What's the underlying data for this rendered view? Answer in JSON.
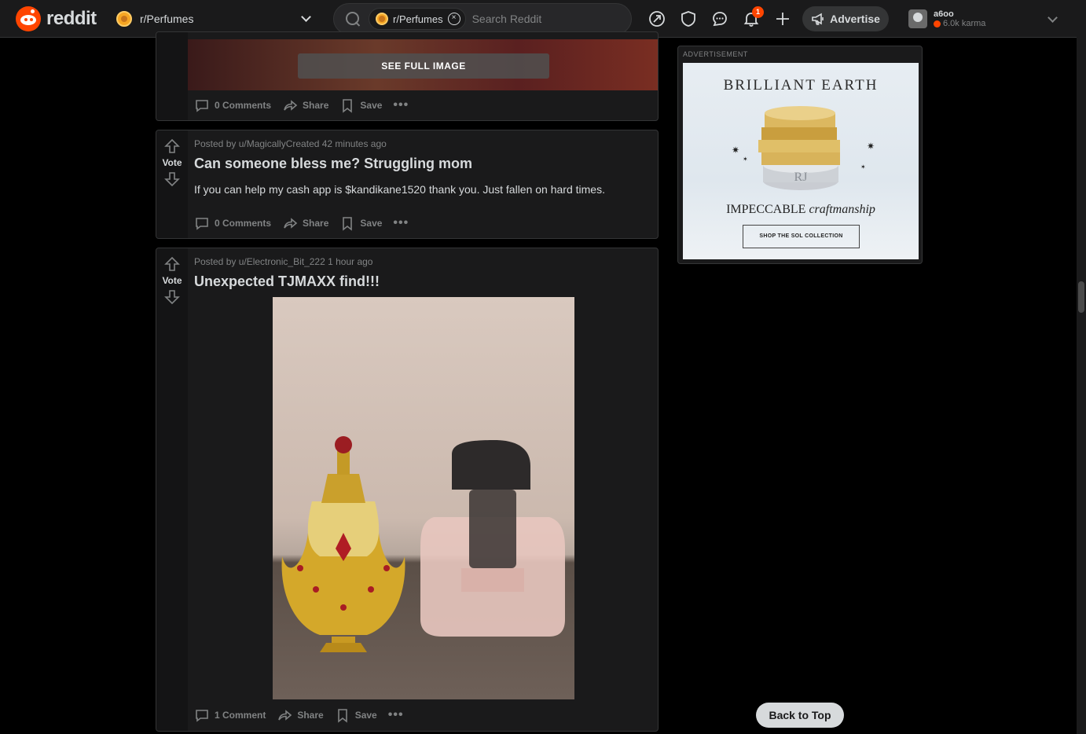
{
  "header": {
    "logo_text": "reddit",
    "community": "r/Perfumes",
    "search_chip": "r/Perfumes",
    "search_placeholder": "Search Reddit",
    "notifications_count": "1",
    "advertise_label": "Advertise",
    "username": "a6oo",
    "karma": "6.0k karma"
  },
  "colors": {
    "accent": "#ff4500",
    "bg": "#000000",
    "card": "#1a1a1b",
    "border": "#343536",
    "text": "#d7dadc",
    "muted": "#818384"
  },
  "posts": [
    {
      "see_full_image": "SEE FULL IMAGE",
      "comments": "0 Comments",
      "share": "Share",
      "save": "Save"
    },
    {
      "vote_label": "Vote",
      "meta": "Posted by u/MagicallyCreated 42 minutes ago",
      "title": "Can someone bless me? Struggling mom",
      "text": "If you can help my cash app is $kandikane1520 thank you. Just fallen on hard times.",
      "comments": "0 Comments",
      "share": "Share",
      "save": "Save"
    },
    {
      "vote_label": "Vote",
      "meta": "Posted by u/Electronic_Bit_222 1 hour ago",
      "title": "Unexpected TJMAXX find!!!",
      "comments": "1 Comment",
      "share": "Share",
      "save": "Save"
    }
  ],
  "ad": {
    "label": "ADVERTISEMENT",
    "brand": "BRILLIANT EARTH",
    "tagline_plain": "IMPECCABLE ",
    "tagline_italic": "craftmanship",
    "cta": "SHOP THE SOL COLLECTION"
  },
  "back_to_top": "Back to Top",
  "icons": [
    "search-icon",
    "close-icon",
    "popular-icon",
    "shield-icon",
    "chat-icon",
    "bell-icon",
    "plus-icon",
    "megaphone-icon",
    "chevron-down-icon",
    "upvote-icon",
    "downvote-icon",
    "comment-icon",
    "share-icon",
    "bookmark-icon",
    "more-icon"
  ]
}
